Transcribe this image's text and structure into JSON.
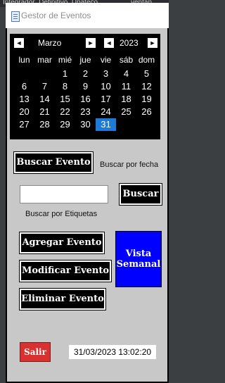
{
  "background_ide": {
    "left_text": "Integrador_Definitivo_Upateco",
    "right_text": "ventan"
  },
  "window": {
    "title": "Gestor de Eventos"
  },
  "calendar": {
    "month": "Marzo",
    "year": "2023",
    "weekdays": [
      "lun",
      "mar",
      "mié",
      "jue",
      "vie",
      "sáb",
      "dom"
    ],
    "weeks": [
      [
        "",
        "",
        "1",
        "2",
        "3",
        "4",
        "5"
      ],
      [
        "6",
        "7",
        "8",
        "9",
        "10",
        "11",
        "12"
      ],
      [
        "13",
        "14",
        "15",
        "16",
        "17",
        "18",
        "19"
      ],
      [
        "20",
        "21",
        "22",
        "23",
        "24",
        "25",
        "26"
      ],
      [
        "27",
        "28",
        "29",
        "30",
        "31",
        "",
        ""
      ]
    ],
    "selected_day": "31",
    "nav_prev": "◄",
    "nav_next": "►"
  },
  "buttons": {
    "buscar_evento": "Buscar Evento",
    "buscar": "Buscar",
    "agregar": "Agregar Evento",
    "modificar": "Modificar Evento",
    "eliminar": "Eliminar Evento",
    "vista_semanal": "Vista Semanal",
    "salir": "Salir"
  },
  "labels": {
    "buscar_por_fecha": "Buscar por fecha",
    "buscar_por_etiquetas": "Buscar por Etiquetas"
  },
  "search": {
    "value": "",
    "placeholder": ""
  },
  "status": {
    "datetime": "31/03/2023 13:02:20"
  },
  "colors": {
    "accent_blue": "#0000ff",
    "selected_day": "#1e7ad6",
    "exit_red": "#d93030"
  }
}
